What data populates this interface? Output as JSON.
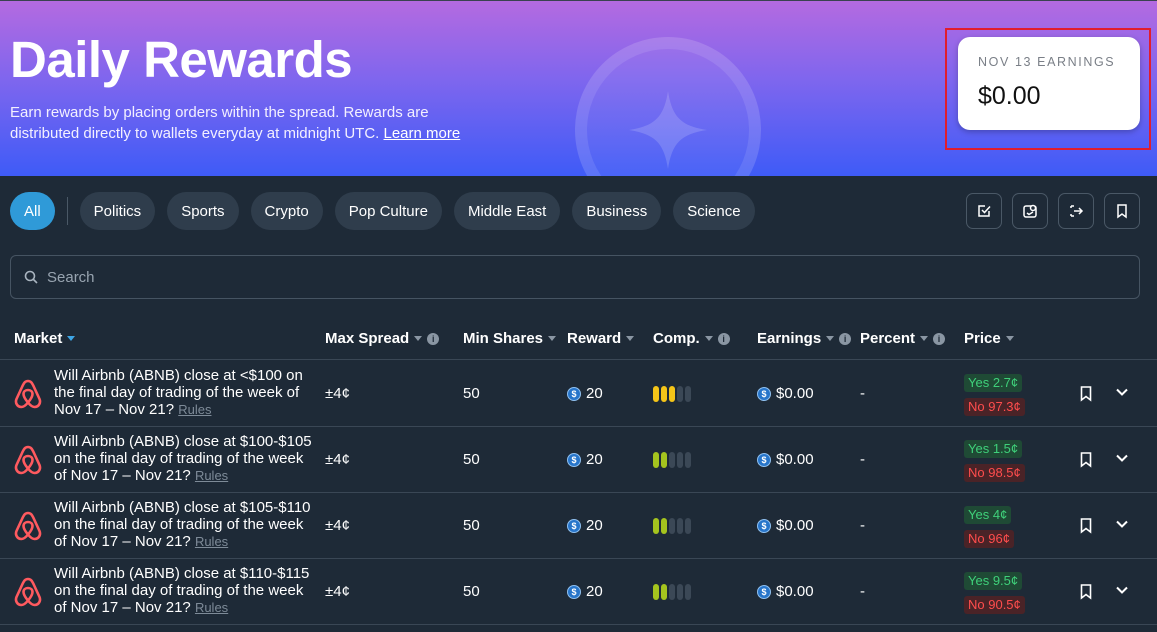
{
  "hero": {
    "title": "Daily Rewards",
    "description": "Earn rewards by placing orders within the spread. Rewards are distributed directly to wallets everyday at midnight UTC.",
    "learn_more": "Learn more"
  },
  "earnings_card": {
    "label": "NOV 13 EARNINGS",
    "value": "$0.00"
  },
  "filters": [
    "All",
    "Politics",
    "Sports",
    "Crypto",
    "Pop Culture",
    "Middle East",
    "Business",
    "Science"
  ],
  "active_filter": "All",
  "toolbar_icons": [
    "check-square-icon",
    "reward-badge-icon",
    "logout-arrow-icon",
    "bookmark-icon"
  ],
  "search": {
    "placeholder": "Search"
  },
  "columns": {
    "market": "Market",
    "max_spread": "Max Spread",
    "min_shares": "Min Shares",
    "reward": "Reward",
    "comp": "Comp.",
    "earnings": "Earnings",
    "percent": "Percent",
    "price": "Price"
  },
  "rows": [
    {
      "market": "Will Airbnb (ABNB) close at <$100 on the final day of trading of the week of Nov 17 – Nov 21?",
      "rules": "Rules",
      "max_spread": "±4¢",
      "min_shares": "50",
      "reward": "20",
      "comp_level": 3,
      "comp_color": "#f5c518",
      "earnings": "$0.00",
      "percent": "-",
      "yes": "Yes 2.7¢",
      "no": "No 97.3¢"
    },
    {
      "market": "Will Airbnb (ABNB) close at $100-$105 on the final day of trading of the week of Nov 17 – Nov 21?",
      "rules": "Rules",
      "max_spread": "±4¢",
      "min_shares": "50",
      "reward": "20",
      "comp_level": 2,
      "comp_color": "#a5c41e",
      "earnings": "$0.00",
      "percent": "-",
      "yes": "Yes 1.5¢",
      "no": "No 98.5¢"
    },
    {
      "market": "Will Airbnb (ABNB) close at $105-$110 on the final day of trading of the week of Nov 17 – Nov 21?",
      "rules": "Rules",
      "max_spread": "±4¢",
      "min_shares": "50",
      "reward": "20",
      "comp_level": 2,
      "comp_color": "#a5c41e",
      "earnings": "$0.00",
      "percent": "-",
      "yes": "Yes 4¢",
      "no": "No 96¢"
    },
    {
      "market": "Will Airbnb (ABNB) close at $110-$115 on the final day of trading of the week of Nov 17 – Nov 21?",
      "rules": "Rules",
      "max_spread": "±4¢",
      "min_shares": "50",
      "reward": "20",
      "comp_level": 2,
      "comp_color": "#a5c41e",
      "earnings": "$0.00",
      "percent": "-",
      "yes": "Yes 9.5¢",
      "no": "No 90.5¢"
    }
  ]
}
